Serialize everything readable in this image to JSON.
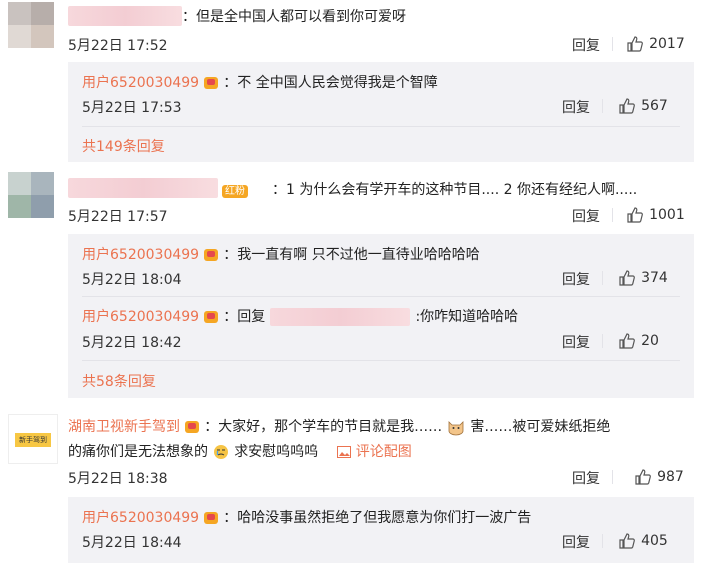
{
  "comments": [
    {
      "text": "：但是全中国人都可以看到你可爱呀",
      "time": "5月22日 17:52",
      "reply_label": "回复",
      "likes": "2017",
      "replies": [
        {
          "user": "用户6520030499",
          "text": "：不 全中国人民会觉得我是个智障",
          "time": "5月22日 17:53",
          "reply_label": "回复",
          "likes": "567"
        }
      ],
      "more": "共149条回复"
    },
    {
      "text": "：1 为什么会有学开车的这种节目.... 2 你还有经纪人啊.....",
      "time": "5月22日 17:57",
      "reply_label": "回复",
      "likes": "1001",
      "replies": [
        {
          "user": "用户6520030499",
          "text": "：我一直有啊 只不过他一直待业哈哈哈哈",
          "time": "5月22日 18:04",
          "reply_label": "回复",
          "likes": "374"
        },
        {
          "user": "用户6520030499",
          "text_prefix": "：回复",
          "text": ":你咋知道哈哈哈",
          "time": "5月22日 18:42",
          "reply_label": "回复",
          "likes": "20"
        }
      ],
      "more": "共58条回复"
    },
    {
      "user": "湖南卫视新手驾到",
      "text1": "：大家好，那个学车的节目就是我……",
      "text2": "害……被可爱妹纸拒绝",
      "text3": "的痛你们是无法想象的",
      "text4": "求安慰呜呜呜",
      "pic_label": "评论配图",
      "time": "5月22日 18:38",
      "reply_label": "回复",
      "likes": "987",
      "replies": [
        {
          "user": "用户6520030499",
          "text": "：哈哈没事虽然拒绝了但我愿意为你们打一波广告",
          "time": "5月22日 18:44",
          "reply_label": "回复",
          "likes": "405"
        }
      ]
    }
  ],
  "avatar_badge": "新手驾到",
  "vip_badge": "红粉"
}
